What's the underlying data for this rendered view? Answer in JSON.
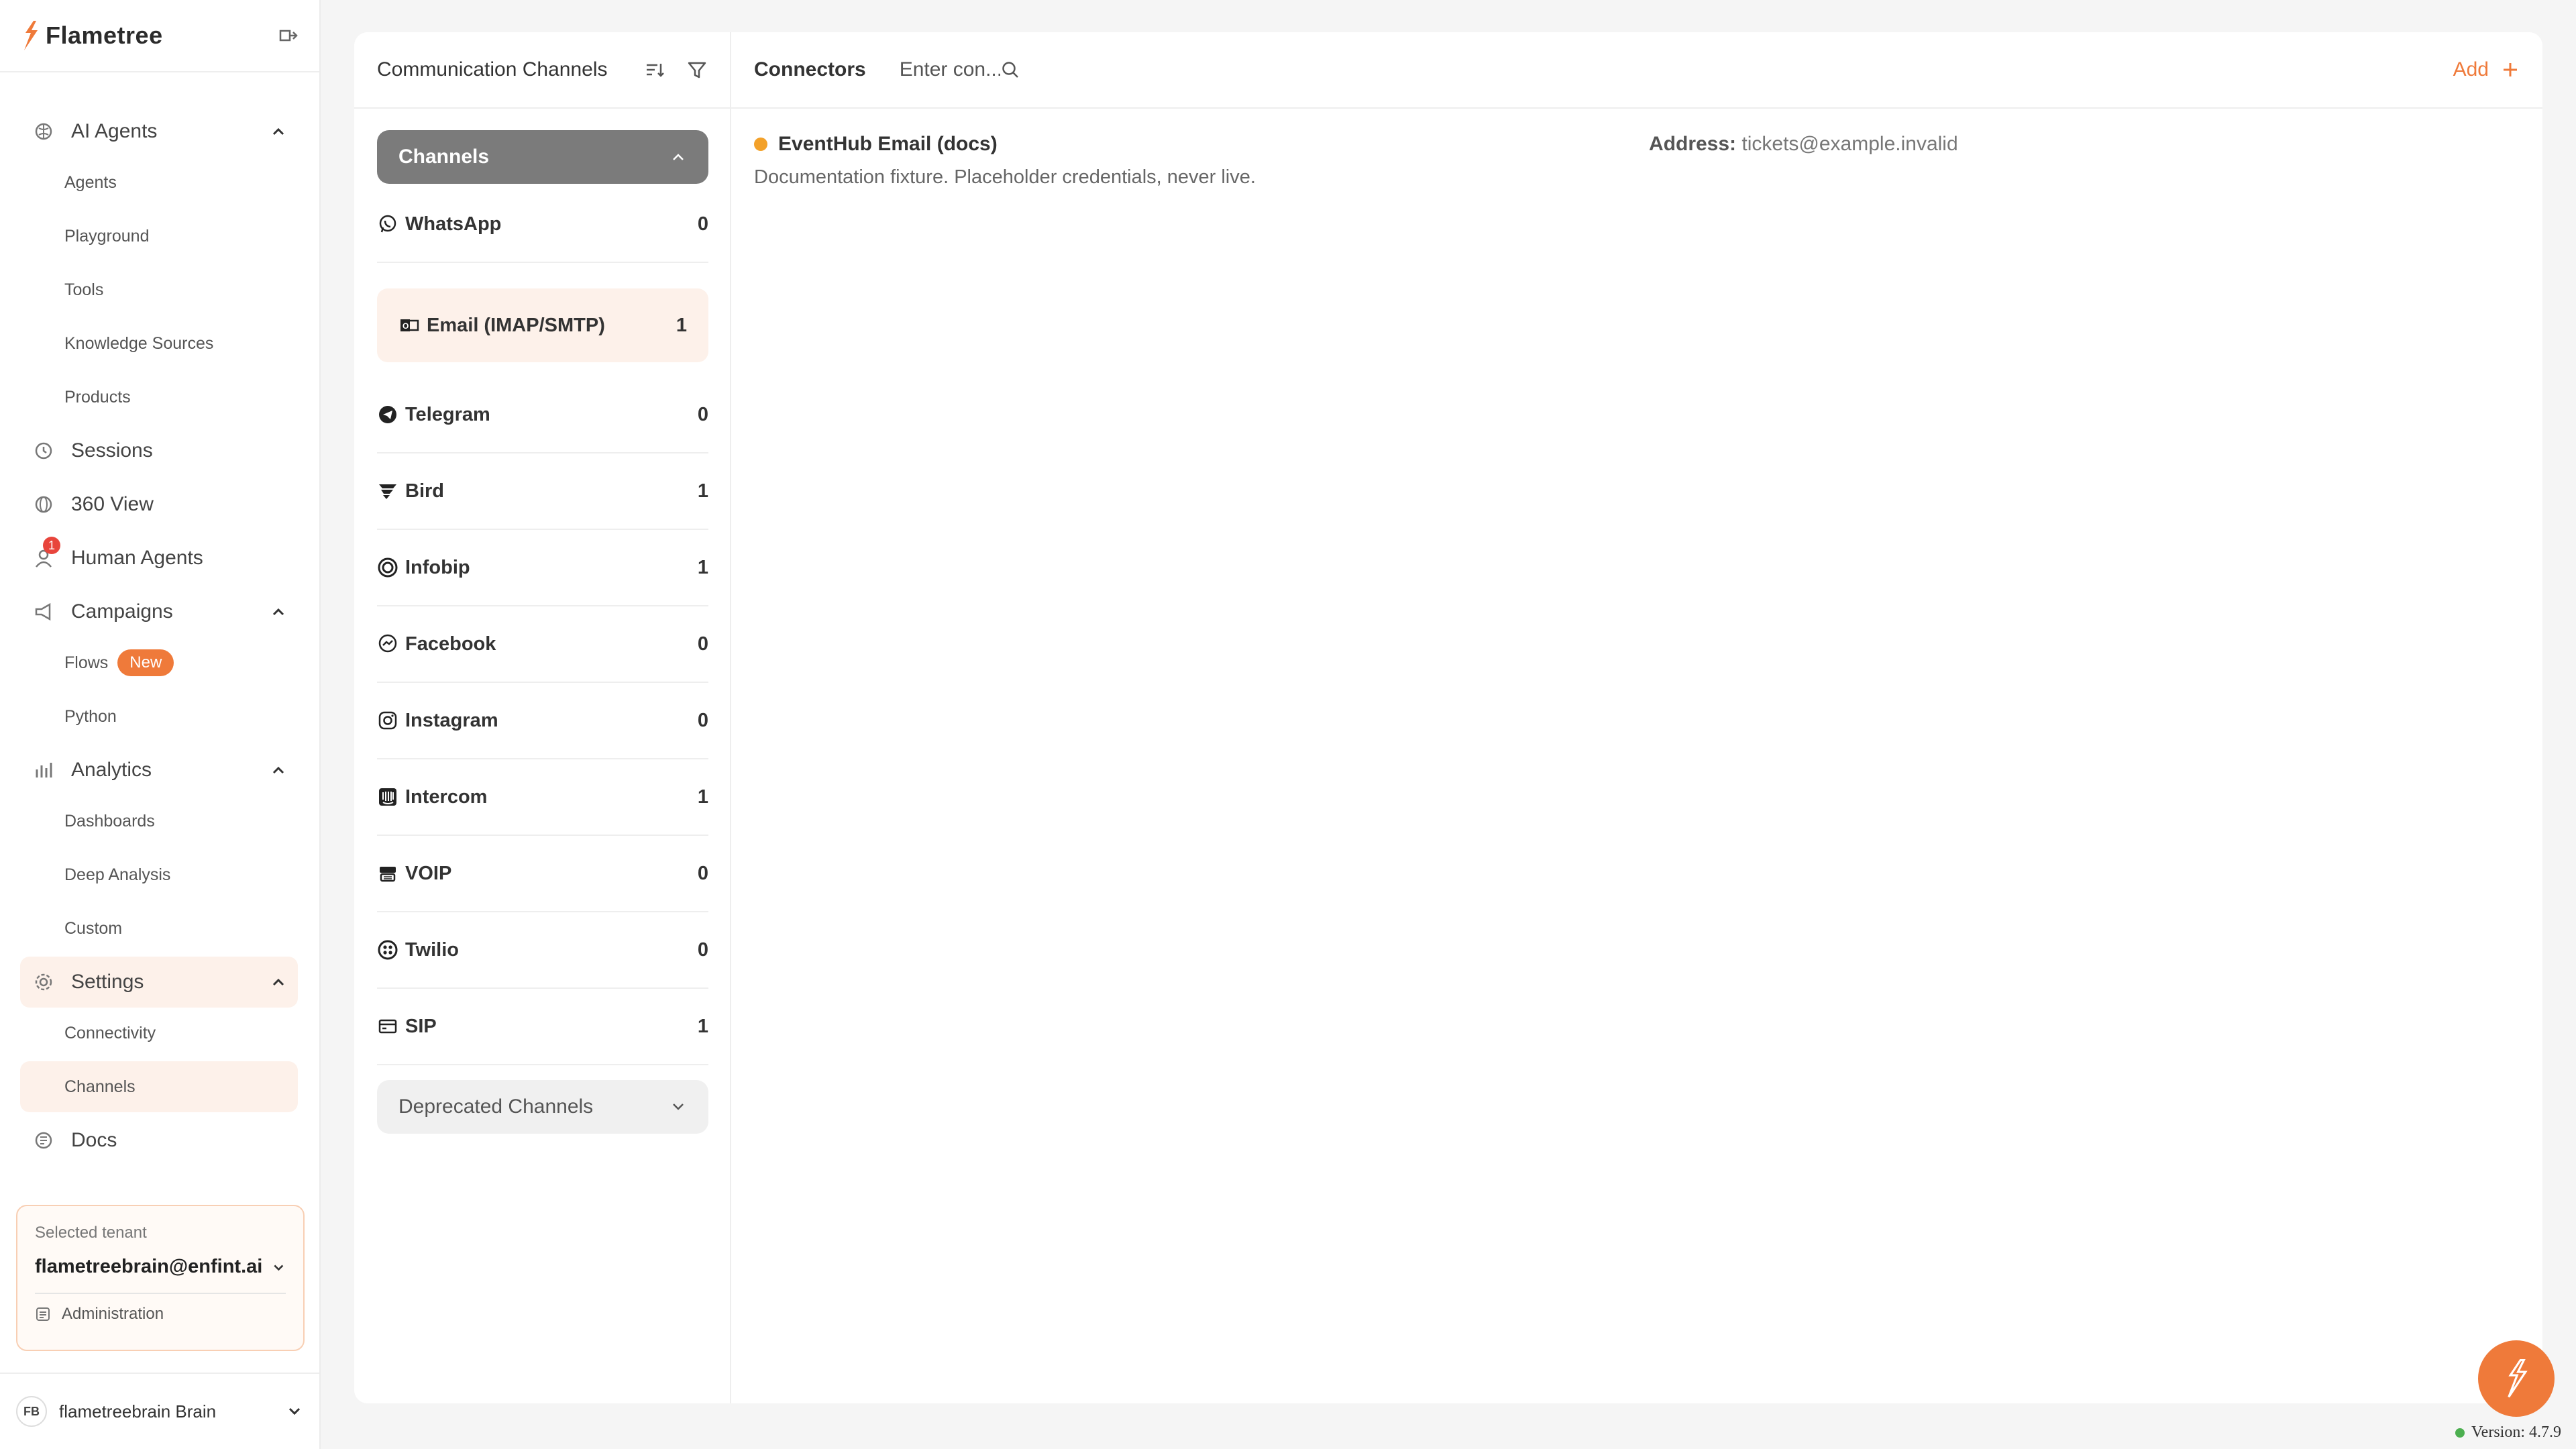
{
  "brand": {
    "name": "Flametree",
    "accent": "#ef7a3a"
  },
  "sidebar": {
    "main_items": [
      {
        "label": "AI Agents",
        "icon": "brain-icon"
      },
      {
        "label": "Sessions",
        "icon": "history-icon"
      },
      {
        "label": "360 View",
        "icon": "globe-icon"
      },
      {
        "label": "Human Agents",
        "icon": "user-icon",
        "badge": "1"
      },
      {
        "label": "Campaigns",
        "icon": "megaphone-icon"
      },
      {
        "label": "Analytics",
        "icon": "bar-chart-icon"
      },
      {
        "label": "Settings",
        "icon": "gear-icon"
      },
      {
        "label": "Docs",
        "icon": "docs-icon"
      }
    ],
    "ai_agents_sub": [
      "Agents",
      "Playground",
      "Tools",
      "Knowledge Sources",
      "Products"
    ],
    "campaigns_sub": {
      "flows": "Flows",
      "flows_badge": "New",
      "python": "Python"
    },
    "analytics_sub": [
      "Dashboards",
      "Deep Analysis",
      "Custom"
    ],
    "settings_sub": [
      "Connectivity",
      "Channels"
    ],
    "tenant": {
      "label": "Selected tenant",
      "name": "flametreebrain@enfint.ai",
      "admin": "Administration"
    },
    "user": {
      "initials": "FB",
      "name": "flametreebrain Brain"
    }
  },
  "channels_panel": {
    "title": "Communication Channels",
    "group_label": "Channels",
    "deprecated_label": "Deprecated Channels",
    "channels": [
      {
        "name": "WhatsApp",
        "count": "0",
        "icon": "whatsapp-icon"
      },
      {
        "name": "Email (IMAP/SMTP)",
        "count": "1",
        "icon": "email-icon"
      },
      {
        "name": "Telegram",
        "count": "0",
        "icon": "telegram-icon"
      },
      {
        "name": "Bird",
        "count": "1",
        "icon": "bird-icon"
      },
      {
        "name": "Infobip",
        "count": "1",
        "icon": "infobip-icon"
      },
      {
        "name": "Facebook",
        "count": "0",
        "icon": "messenger-icon"
      },
      {
        "name": "Instagram",
        "count": "0",
        "icon": "instagram-icon"
      },
      {
        "name": "Intercom",
        "count": "1",
        "icon": "intercom-icon"
      },
      {
        "name": "VOIP",
        "count": "0",
        "icon": "voip-icon"
      },
      {
        "name": "Twilio",
        "count": "0",
        "icon": "twilio-icon"
      },
      {
        "name": "SIP",
        "count": "1",
        "icon": "sip-icon"
      }
    ]
  },
  "connectors_panel": {
    "title": "Connectors",
    "search_placeholder": "Enter con...",
    "add_label": "Add",
    "items": [
      {
        "name": "EventHub Email (docs)",
        "status_color": "#f3a12a",
        "description": "Documentation fixture. Placeholder credentials, never live.",
        "address_label": "Address:",
        "address": "tickets@example.invalid"
      }
    ]
  },
  "version": "Version: 4.7.9"
}
